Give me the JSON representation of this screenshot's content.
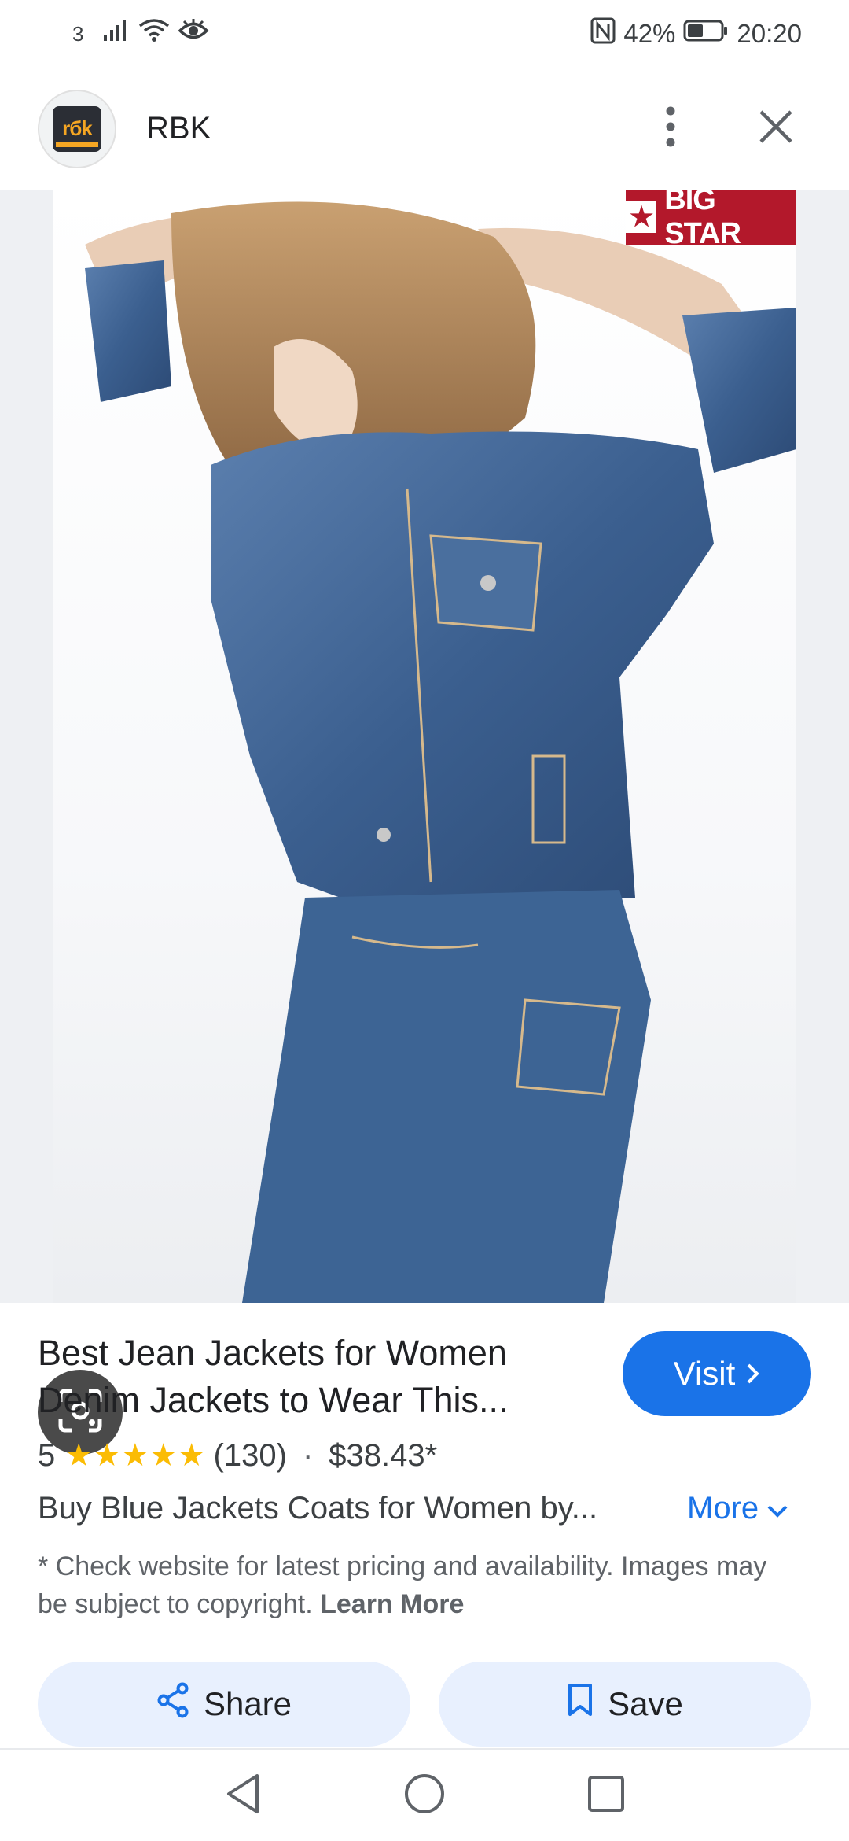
{
  "status_bar": {
    "sim": "3",
    "battery": "42%",
    "time": "20:20",
    "icons": [
      "signal-icon",
      "wifi-icon",
      "eye-icon",
      "nfc-icon",
      "battery-icon"
    ]
  },
  "header": {
    "site_name": "RBK",
    "logo_text": "rбk",
    "actions": [
      "more-vert-icon",
      "close-icon"
    ]
  },
  "image": {
    "brand_badge": "BIG STAR",
    "lens_icon": "lens-icon"
  },
  "product": {
    "title": "Best Jean Jackets for Women Denim Jackets to Wear This...",
    "visit_label": "Visit",
    "rating": "5",
    "stars": 5,
    "review_count": "(130)",
    "separator": "·",
    "price": "$38.43*",
    "description": "Buy Blue Jackets Coats for Women by...",
    "more_label": "More",
    "disclaimer": "* Check website for latest pricing and availability. Images may be subject to copyright.",
    "learn_more": "Learn More"
  },
  "actions": {
    "share_label": "Share",
    "save_label": "Save"
  },
  "colors": {
    "accent": "#1a73e8",
    "star": "#fbbc04",
    "badge": "#b3182b",
    "action_bg": "#e8f0fe"
  }
}
